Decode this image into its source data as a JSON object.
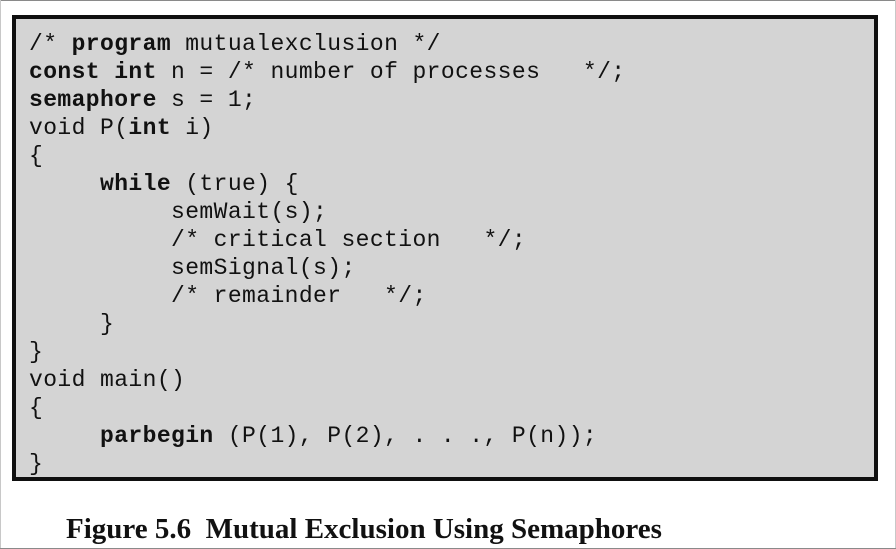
{
  "code_lines": [
    [
      {
        "t": "/* "
      },
      {
        "t": "program",
        "b": true
      },
      {
        "t": " mutualexclusion */"
      }
    ],
    [
      {
        "t": "const",
        "b": true
      },
      {
        "t": " "
      },
      {
        "t": "int",
        "b": true
      },
      {
        "t": " n = /* number of processes   */;"
      }
    ],
    [
      {
        "t": "semaphore",
        "b": true
      },
      {
        "t": " s = 1;"
      }
    ],
    [
      {
        "t": "void P("
      },
      {
        "t": "int",
        "b": true
      },
      {
        "t": " i)"
      }
    ],
    [
      {
        "t": "{"
      }
    ],
    [
      {
        "t": "     "
      },
      {
        "t": "while",
        "b": true
      },
      {
        "t": " (true) {"
      }
    ],
    [
      {
        "t": "          semWait(s);"
      }
    ],
    [
      {
        "t": "          /* critical section   */;"
      }
    ],
    [
      {
        "t": "          semSignal(s);"
      }
    ],
    [
      {
        "t": "          /* remainder   */;"
      }
    ],
    [
      {
        "t": "     }"
      }
    ],
    [
      {
        "t": "}"
      }
    ],
    [
      {
        "t": "void main()"
      }
    ],
    [
      {
        "t": "{"
      }
    ],
    [
      {
        "t": "     "
      },
      {
        "t": "parbegin",
        "b": true
      },
      {
        "t": " (P(1), P(2), . . ., P(n));"
      }
    ],
    [
      {
        "t": "}"
      }
    ]
  ],
  "caption": "Figure 5.6  Mutual Exclusion Using Semaphores"
}
